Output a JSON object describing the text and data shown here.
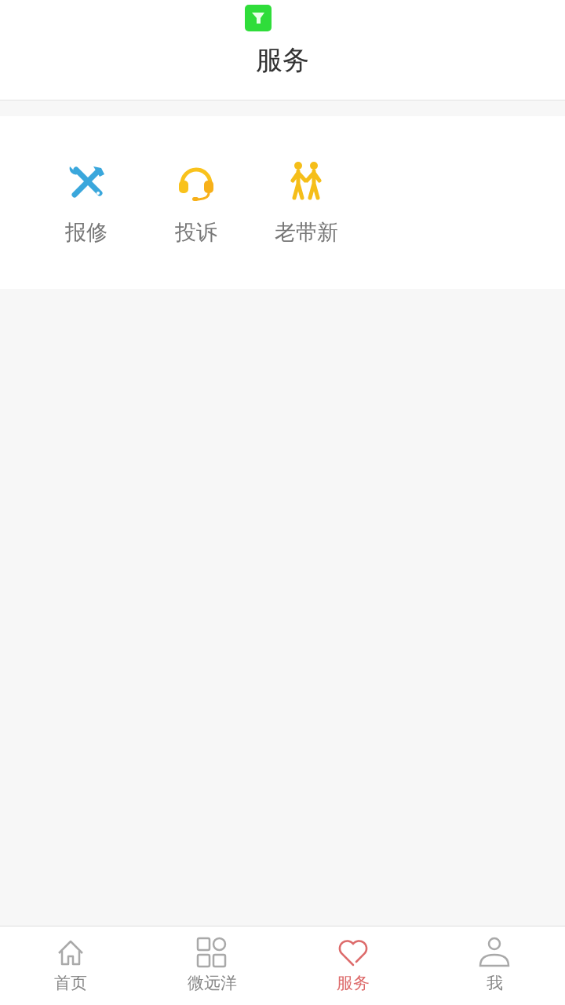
{
  "header": {
    "title": "服务"
  },
  "services": [
    {
      "kind": "repair",
      "label": "报修"
    },
    {
      "kind": "headset",
      "label": "投诉"
    },
    {
      "kind": "walkers",
      "label": "老带新"
    }
  ],
  "tabs": [
    {
      "kind": "home",
      "label": "首页",
      "selected": false
    },
    {
      "kind": "grid",
      "label": "微远洋",
      "selected": false
    },
    {
      "kind": "heart",
      "label": "服务",
      "selected": true
    },
    {
      "kind": "person",
      "label": "我",
      "selected": false
    }
  ]
}
